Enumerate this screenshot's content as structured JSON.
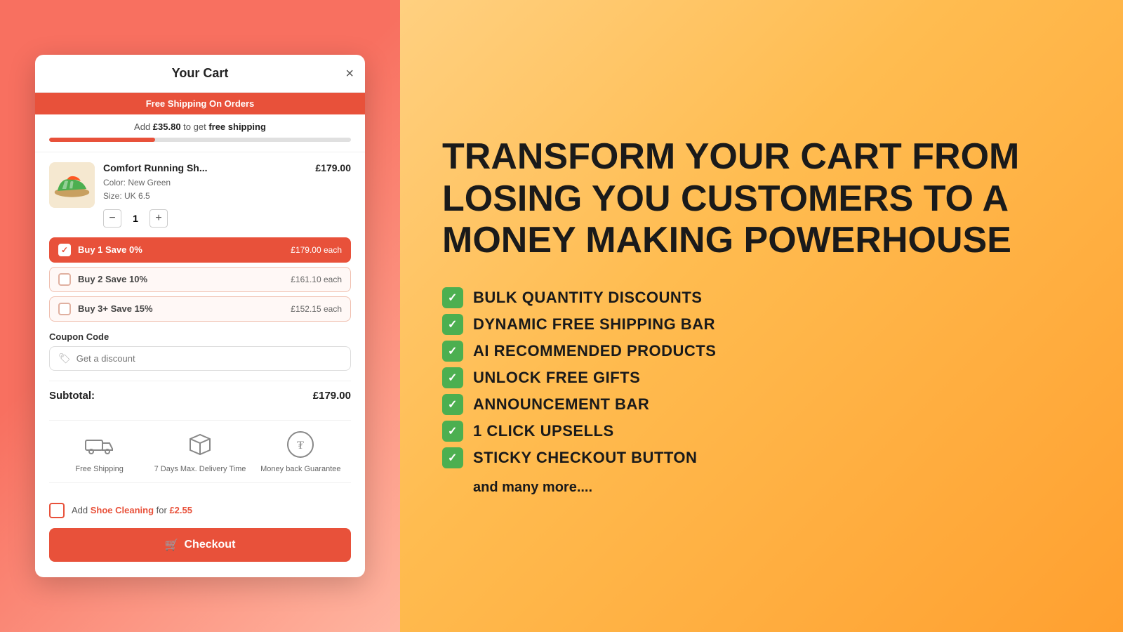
{
  "leftPanel": {
    "cart": {
      "title": "Your Cart",
      "close": "×",
      "banner": "Free Shipping On Orders",
      "shippingProgress": {
        "prefix": "Add ",
        "amount": "£35.80",
        "suffix": " to get ",
        "label": "free shipping"
      },
      "progressPercent": 35,
      "item": {
        "name": "Comfort Running Sh...",
        "price": "£179.00",
        "color": "New Green",
        "size": "UK 6.5",
        "qty": 1
      },
      "bulkOptions": [
        {
          "label": "Buy 1 Save 0%",
          "price": "£179.00 each",
          "active": true
        },
        {
          "label": "Buy 2 Save 10%",
          "price": "£161.10 each",
          "active": false
        },
        {
          "label": "Buy 3+ Save 15%",
          "price": "£152.15 each",
          "active": false
        }
      ],
      "coupon": {
        "label": "Coupon Code",
        "placeholder": "Get a discount"
      },
      "subtotal": {
        "label": "Subtotal:",
        "value": "£179.00"
      },
      "trustBadges": [
        {
          "label": "Free Shipping"
        },
        {
          "label": "7 Days Max. Delivery Time"
        },
        {
          "label": "Money back Guarantee"
        }
      ],
      "addon": {
        "prefix": "Add ",
        "product": "Shoe Cleaning",
        "middle": " for ",
        "price": "£2.55"
      },
      "checkoutLabel": "Checkout"
    }
  },
  "rightPanel": {
    "title": "TRANSFORM YOUR CART FROM LOSING YOU CUSTOMERS TO A MONEY MAKING POWERHOUSE",
    "features": [
      "BULK QUANTITY DISCOUNTS",
      "DYNAMIC FREE SHIPPING BAR",
      "AI RECOMMENDED PRODUCTS",
      "UNLOCK FREE GIFTS",
      "ANNOUNCEMENT BAR",
      "1 CLICK UPSELLS",
      "STICKY CHECKOUT BUTTON"
    ],
    "andMore": "and many more...."
  }
}
